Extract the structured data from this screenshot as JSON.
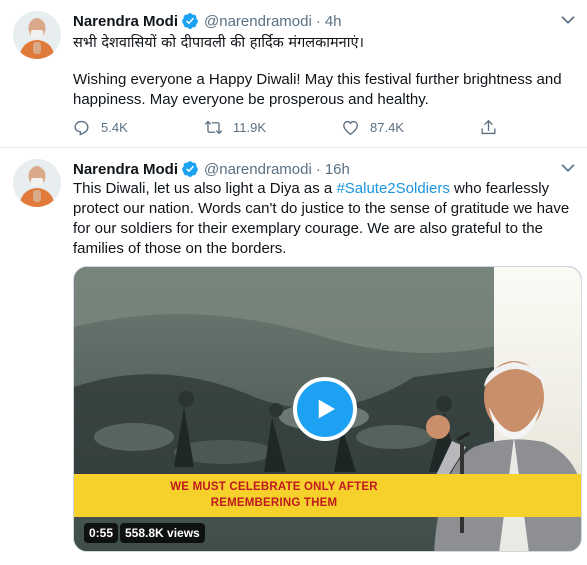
{
  "tweets": [
    {
      "author_name": "Narendra Modi",
      "handle": "@narendramodi",
      "separator": "·",
      "time": "4h",
      "text_hindi": "सभी देशवासियों को दीपावली की हार्दिक मंगलकामनाएं।",
      "text": "Wishing everyone a Happy Diwali! May this festival further brightness and happiness. May everyone be prosperous and healthy.",
      "replies": "5.4K",
      "retweets": "11.9K",
      "likes": "87.4K"
    },
    {
      "author_name": "Narendra Modi",
      "handle": "@narendramodi",
      "separator": "·",
      "time": "16h",
      "text_before": "This Diwali, let us also light a Diya as a ",
      "hashtag": "#Salute2Soldiers",
      "text_after": " who fearlessly protect our nation. Words can't do justice to the sense of gratitude we have for our soldiers for their exemplary courage. We are also grateful to the families of those on the borders.",
      "video": {
        "caption": "WE MUST CELEBRATE ONLY AFTER REMEMBERING THEM",
        "duration": "0:55",
        "views": "558.8K views"
      }
    }
  ],
  "icons": {
    "verified": "verified-badge-icon",
    "more": "more-options-icon",
    "reply": "reply-icon",
    "retweet": "retweet-icon",
    "like": "like-icon",
    "share": "share-icon",
    "play": "play-icon"
  },
  "colors": {
    "accent": "#1da1f2",
    "hashtag": "#1b95e0",
    "muted": "#5b7083",
    "banner": "#f6d02b",
    "banner_text": "#c0191f"
  }
}
